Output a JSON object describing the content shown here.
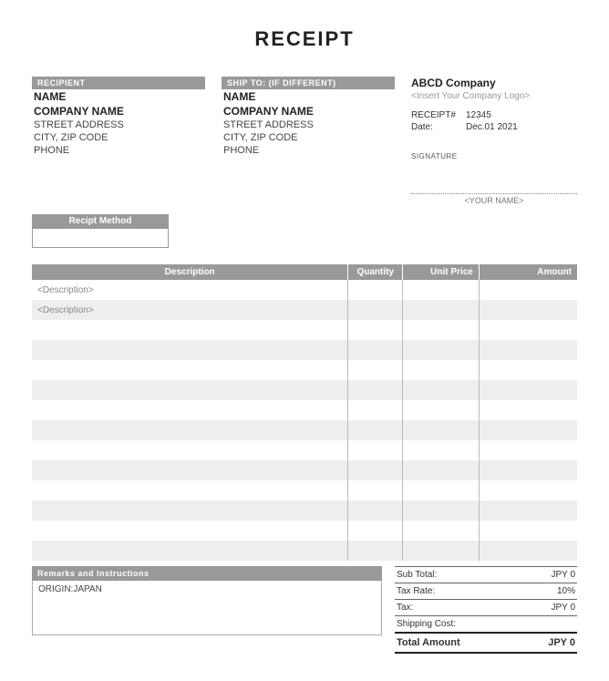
{
  "title": "RECEIPT",
  "recipient": {
    "header": "RECIPIENT",
    "name": "NAME",
    "company": "COMPANY NAME",
    "street": "STREET ADDRESS",
    "cityzip": "CITY, ZIP CODE",
    "phone": "PHONE"
  },
  "shipto": {
    "header": "SHIP TO:  (IF DIFFERENT)",
    "name": "NAME",
    "company": "COMPANY NAME",
    "street": "STREET ADDRESS",
    "cityzip": "CITY, ZIP CODE",
    "phone": "PHONE"
  },
  "company": {
    "name": "ABCD Company",
    "logo_placeholder": "<Insert Your Company Logo>",
    "receipt_label": "RECEIPT#",
    "receipt_number": "12345",
    "date_label": "Date:",
    "date_value": "Dec.01 2021"
  },
  "signature": {
    "label": "SIGNATURE",
    "name_placeholder": "<YOUR NAME>"
  },
  "method": {
    "header": "Recipt Method",
    "value": ""
  },
  "table": {
    "headers": {
      "desc": "Description",
      "qty": "Quantity",
      "price": "Unit Price",
      "amount": "Amount"
    },
    "rows": [
      {
        "desc": "<Description>",
        "qty": "",
        "price": "",
        "amount": ""
      },
      {
        "desc": "<Description>",
        "qty": "",
        "price": "",
        "amount": ""
      },
      {
        "desc": "",
        "qty": "",
        "price": "",
        "amount": ""
      },
      {
        "desc": "",
        "qty": "",
        "price": "",
        "amount": ""
      },
      {
        "desc": "",
        "qty": "",
        "price": "",
        "amount": ""
      },
      {
        "desc": "",
        "qty": "",
        "price": "",
        "amount": ""
      },
      {
        "desc": "",
        "qty": "",
        "price": "",
        "amount": ""
      },
      {
        "desc": "",
        "qty": "",
        "price": "",
        "amount": ""
      },
      {
        "desc": "",
        "qty": "",
        "price": "",
        "amount": ""
      },
      {
        "desc": "",
        "qty": "",
        "price": "",
        "amount": ""
      },
      {
        "desc": "",
        "qty": "",
        "price": "",
        "amount": ""
      },
      {
        "desc": "",
        "qty": "",
        "price": "",
        "amount": ""
      },
      {
        "desc": "",
        "qty": "",
        "price": "",
        "amount": ""
      },
      {
        "desc": "",
        "qty": "",
        "price": "",
        "amount": ""
      }
    ]
  },
  "remarks": {
    "header": "Remarks and Instructions",
    "body": "ORIGIN:JAPAN"
  },
  "totals": {
    "subtotal_label": "Sub Total:",
    "subtotal_value": "JPY 0",
    "taxrate_label": "Tax Rate:",
    "taxrate_value": "10%",
    "tax_label": "Tax:",
    "tax_value": "JPY 0",
    "shipping_label": "Shipping Cost:",
    "shipping_value": "",
    "total_label": "Total Amount",
    "total_value": "JPY 0"
  }
}
